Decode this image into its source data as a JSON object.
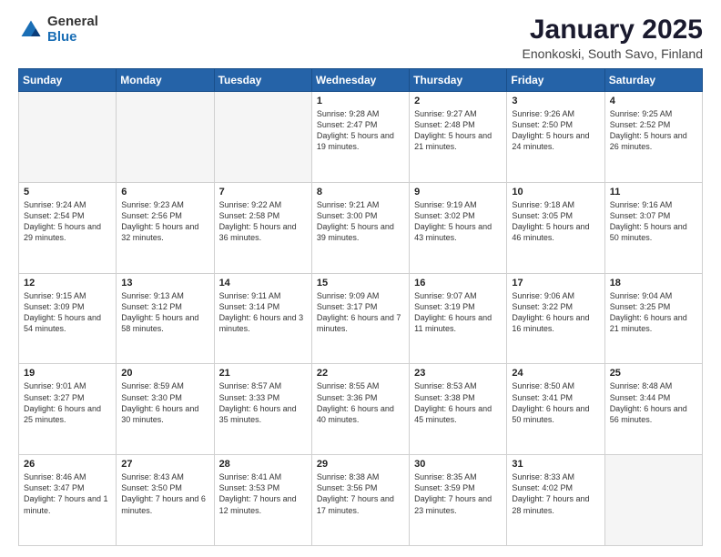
{
  "logo": {
    "general": "General",
    "blue": "Blue"
  },
  "header": {
    "title": "January 2025",
    "subtitle": "Enonkoski, South Savo, Finland"
  },
  "weekdays": [
    "Sunday",
    "Monday",
    "Tuesday",
    "Wednesday",
    "Thursday",
    "Friday",
    "Saturday"
  ],
  "weeks": [
    [
      {
        "day": "",
        "sunrise": "",
        "sunset": "",
        "daylight": ""
      },
      {
        "day": "",
        "sunrise": "",
        "sunset": "",
        "daylight": ""
      },
      {
        "day": "",
        "sunrise": "",
        "sunset": "",
        "daylight": ""
      },
      {
        "day": "1",
        "sunrise": "Sunrise: 9:28 AM",
        "sunset": "Sunset: 2:47 PM",
        "daylight": "Daylight: 5 hours and 19 minutes."
      },
      {
        "day": "2",
        "sunrise": "Sunrise: 9:27 AM",
        "sunset": "Sunset: 2:48 PM",
        "daylight": "Daylight: 5 hours and 21 minutes."
      },
      {
        "day": "3",
        "sunrise": "Sunrise: 9:26 AM",
        "sunset": "Sunset: 2:50 PM",
        "daylight": "Daylight: 5 hours and 24 minutes."
      },
      {
        "day": "4",
        "sunrise": "Sunrise: 9:25 AM",
        "sunset": "Sunset: 2:52 PM",
        "daylight": "Daylight: 5 hours and 26 minutes."
      }
    ],
    [
      {
        "day": "5",
        "sunrise": "Sunrise: 9:24 AM",
        "sunset": "Sunset: 2:54 PM",
        "daylight": "Daylight: 5 hours and 29 minutes."
      },
      {
        "day": "6",
        "sunrise": "Sunrise: 9:23 AM",
        "sunset": "Sunset: 2:56 PM",
        "daylight": "Daylight: 5 hours and 32 minutes."
      },
      {
        "day": "7",
        "sunrise": "Sunrise: 9:22 AM",
        "sunset": "Sunset: 2:58 PM",
        "daylight": "Daylight: 5 hours and 36 minutes."
      },
      {
        "day": "8",
        "sunrise": "Sunrise: 9:21 AM",
        "sunset": "Sunset: 3:00 PM",
        "daylight": "Daylight: 5 hours and 39 minutes."
      },
      {
        "day": "9",
        "sunrise": "Sunrise: 9:19 AM",
        "sunset": "Sunset: 3:02 PM",
        "daylight": "Daylight: 5 hours and 43 minutes."
      },
      {
        "day": "10",
        "sunrise": "Sunrise: 9:18 AM",
        "sunset": "Sunset: 3:05 PM",
        "daylight": "Daylight: 5 hours and 46 minutes."
      },
      {
        "day": "11",
        "sunrise": "Sunrise: 9:16 AM",
        "sunset": "Sunset: 3:07 PM",
        "daylight": "Daylight: 5 hours and 50 minutes."
      }
    ],
    [
      {
        "day": "12",
        "sunrise": "Sunrise: 9:15 AM",
        "sunset": "Sunset: 3:09 PM",
        "daylight": "Daylight: 5 hours and 54 minutes."
      },
      {
        "day": "13",
        "sunrise": "Sunrise: 9:13 AM",
        "sunset": "Sunset: 3:12 PM",
        "daylight": "Daylight: 5 hours and 58 minutes."
      },
      {
        "day": "14",
        "sunrise": "Sunrise: 9:11 AM",
        "sunset": "Sunset: 3:14 PM",
        "daylight": "Daylight: 6 hours and 3 minutes."
      },
      {
        "day": "15",
        "sunrise": "Sunrise: 9:09 AM",
        "sunset": "Sunset: 3:17 PM",
        "daylight": "Daylight: 6 hours and 7 minutes."
      },
      {
        "day": "16",
        "sunrise": "Sunrise: 9:07 AM",
        "sunset": "Sunset: 3:19 PM",
        "daylight": "Daylight: 6 hours and 11 minutes."
      },
      {
        "day": "17",
        "sunrise": "Sunrise: 9:06 AM",
        "sunset": "Sunset: 3:22 PM",
        "daylight": "Daylight: 6 hours and 16 minutes."
      },
      {
        "day": "18",
        "sunrise": "Sunrise: 9:04 AM",
        "sunset": "Sunset: 3:25 PM",
        "daylight": "Daylight: 6 hours and 21 minutes."
      }
    ],
    [
      {
        "day": "19",
        "sunrise": "Sunrise: 9:01 AM",
        "sunset": "Sunset: 3:27 PM",
        "daylight": "Daylight: 6 hours and 25 minutes."
      },
      {
        "day": "20",
        "sunrise": "Sunrise: 8:59 AM",
        "sunset": "Sunset: 3:30 PM",
        "daylight": "Daylight: 6 hours and 30 minutes."
      },
      {
        "day": "21",
        "sunrise": "Sunrise: 8:57 AM",
        "sunset": "Sunset: 3:33 PM",
        "daylight": "Daylight: 6 hours and 35 minutes."
      },
      {
        "day": "22",
        "sunrise": "Sunrise: 8:55 AM",
        "sunset": "Sunset: 3:36 PM",
        "daylight": "Daylight: 6 hours and 40 minutes."
      },
      {
        "day": "23",
        "sunrise": "Sunrise: 8:53 AM",
        "sunset": "Sunset: 3:38 PM",
        "daylight": "Daylight: 6 hours and 45 minutes."
      },
      {
        "day": "24",
        "sunrise": "Sunrise: 8:50 AM",
        "sunset": "Sunset: 3:41 PM",
        "daylight": "Daylight: 6 hours and 50 minutes."
      },
      {
        "day": "25",
        "sunrise": "Sunrise: 8:48 AM",
        "sunset": "Sunset: 3:44 PM",
        "daylight": "Daylight: 6 hours and 56 minutes."
      }
    ],
    [
      {
        "day": "26",
        "sunrise": "Sunrise: 8:46 AM",
        "sunset": "Sunset: 3:47 PM",
        "daylight": "Daylight: 7 hours and 1 minute."
      },
      {
        "day": "27",
        "sunrise": "Sunrise: 8:43 AM",
        "sunset": "Sunset: 3:50 PM",
        "daylight": "Daylight: 7 hours and 6 minutes."
      },
      {
        "day": "28",
        "sunrise": "Sunrise: 8:41 AM",
        "sunset": "Sunset: 3:53 PM",
        "daylight": "Daylight: 7 hours and 12 minutes."
      },
      {
        "day": "29",
        "sunrise": "Sunrise: 8:38 AM",
        "sunset": "Sunset: 3:56 PM",
        "daylight": "Daylight: 7 hours and 17 minutes."
      },
      {
        "day": "30",
        "sunrise": "Sunrise: 8:35 AM",
        "sunset": "Sunset: 3:59 PM",
        "daylight": "Daylight: 7 hours and 23 minutes."
      },
      {
        "day": "31",
        "sunrise": "Sunrise: 8:33 AM",
        "sunset": "Sunset: 4:02 PM",
        "daylight": "Daylight: 7 hours and 28 minutes."
      },
      {
        "day": "",
        "sunrise": "",
        "sunset": "",
        "daylight": ""
      }
    ]
  ]
}
